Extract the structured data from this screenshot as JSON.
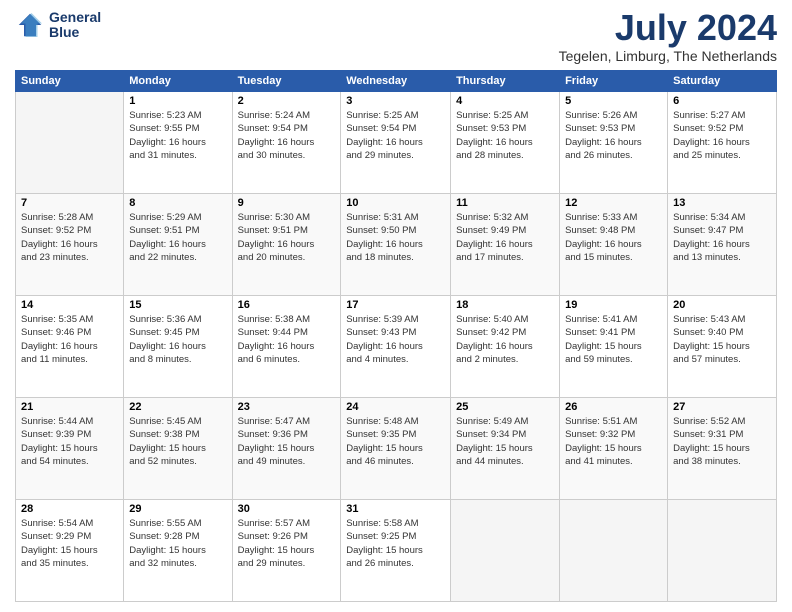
{
  "logo": {
    "line1": "General",
    "line2": "Blue"
  },
  "title": "July 2024",
  "location": "Tegelen, Limburg, The Netherlands",
  "days_of_week": [
    "Sunday",
    "Monday",
    "Tuesday",
    "Wednesday",
    "Thursday",
    "Friday",
    "Saturday"
  ],
  "weeks": [
    [
      {
        "day": "",
        "info": ""
      },
      {
        "day": "1",
        "info": "Sunrise: 5:23 AM\nSunset: 9:55 PM\nDaylight: 16 hours\nand 31 minutes."
      },
      {
        "day": "2",
        "info": "Sunrise: 5:24 AM\nSunset: 9:54 PM\nDaylight: 16 hours\nand 30 minutes."
      },
      {
        "day": "3",
        "info": "Sunrise: 5:25 AM\nSunset: 9:54 PM\nDaylight: 16 hours\nand 29 minutes."
      },
      {
        "day": "4",
        "info": "Sunrise: 5:25 AM\nSunset: 9:53 PM\nDaylight: 16 hours\nand 28 minutes."
      },
      {
        "day": "5",
        "info": "Sunrise: 5:26 AM\nSunset: 9:53 PM\nDaylight: 16 hours\nand 26 minutes."
      },
      {
        "day": "6",
        "info": "Sunrise: 5:27 AM\nSunset: 9:52 PM\nDaylight: 16 hours\nand 25 minutes."
      }
    ],
    [
      {
        "day": "7",
        "info": "Sunrise: 5:28 AM\nSunset: 9:52 PM\nDaylight: 16 hours\nand 23 minutes."
      },
      {
        "day": "8",
        "info": "Sunrise: 5:29 AM\nSunset: 9:51 PM\nDaylight: 16 hours\nand 22 minutes."
      },
      {
        "day": "9",
        "info": "Sunrise: 5:30 AM\nSunset: 9:51 PM\nDaylight: 16 hours\nand 20 minutes."
      },
      {
        "day": "10",
        "info": "Sunrise: 5:31 AM\nSunset: 9:50 PM\nDaylight: 16 hours\nand 18 minutes."
      },
      {
        "day": "11",
        "info": "Sunrise: 5:32 AM\nSunset: 9:49 PM\nDaylight: 16 hours\nand 17 minutes."
      },
      {
        "day": "12",
        "info": "Sunrise: 5:33 AM\nSunset: 9:48 PM\nDaylight: 16 hours\nand 15 minutes."
      },
      {
        "day": "13",
        "info": "Sunrise: 5:34 AM\nSunset: 9:47 PM\nDaylight: 16 hours\nand 13 minutes."
      }
    ],
    [
      {
        "day": "14",
        "info": "Sunrise: 5:35 AM\nSunset: 9:46 PM\nDaylight: 16 hours\nand 11 minutes."
      },
      {
        "day": "15",
        "info": "Sunrise: 5:36 AM\nSunset: 9:45 PM\nDaylight: 16 hours\nand 8 minutes."
      },
      {
        "day": "16",
        "info": "Sunrise: 5:38 AM\nSunset: 9:44 PM\nDaylight: 16 hours\nand 6 minutes."
      },
      {
        "day": "17",
        "info": "Sunrise: 5:39 AM\nSunset: 9:43 PM\nDaylight: 16 hours\nand 4 minutes."
      },
      {
        "day": "18",
        "info": "Sunrise: 5:40 AM\nSunset: 9:42 PM\nDaylight: 16 hours\nand 2 minutes."
      },
      {
        "day": "19",
        "info": "Sunrise: 5:41 AM\nSunset: 9:41 PM\nDaylight: 15 hours\nand 59 minutes."
      },
      {
        "day": "20",
        "info": "Sunrise: 5:43 AM\nSunset: 9:40 PM\nDaylight: 15 hours\nand 57 minutes."
      }
    ],
    [
      {
        "day": "21",
        "info": "Sunrise: 5:44 AM\nSunset: 9:39 PM\nDaylight: 15 hours\nand 54 minutes."
      },
      {
        "day": "22",
        "info": "Sunrise: 5:45 AM\nSunset: 9:38 PM\nDaylight: 15 hours\nand 52 minutes."
      },
      {
        "day": "23",
        "info": "Sunrise: 5:47 AM\nSunset: 9:36 PM\nDaylight: 15 hours\nand 49 minutes."
      },
      {
        "day": "24",
        "info": "Sunrise: 5:48 AM\nSunset: 9:35 PM\nDaylight: 15 hours\nand 46 minutes."
      },
      {
        "day": "25",
        "info": "Sunrise: 5:49 AM\nSunset: 9:34 PM\nDaylight: 15 hours\nand 44 minutes."
      },
      {
        "day": "26",
        "info": "Sunrise: 5:51 AM\nSunset: 9:32 PM\nDaylight: 15 hours\nand 41 minutes."
      },
      {
        "day": "27",
        "info": "Sunrise: 5:52 AM\nSunset: 9:31 PM\nDaylight: 15 hours\nand 38 minutes."
      }
    ],
    [
      {
        "day": "28",
        "info": "Sunrise: 5:54 AM\nSunset: 9:29 PM\nDaylight: 15 hours\nand 35 minutes."
      },
      {
        "day": "29",
        "info": "Sunrise: 5:55 AM\nSunset: 9:28 PM\nDaylight: 15 hours\nand 32 minutes."
      },
      {
        "day": "30",
        "info": "Sunrise: 5:57 AM\nSunset: 9:26 PM\nDaylight: 15 hours\nand 29 minutes."
      },
      {
        "day": "31",
        "info": "Sunrise: 5:58 AM\nSunset: 9:25 PM\nDaylight: 15 hours\nand 26 minutes."
      },
      {
        "day": "",
        "info": ""
      },
      {
        "day": "",
        "info": ""
      },
      {
        "day": "",
        "info": ""
      }
    ]
  ]
}
